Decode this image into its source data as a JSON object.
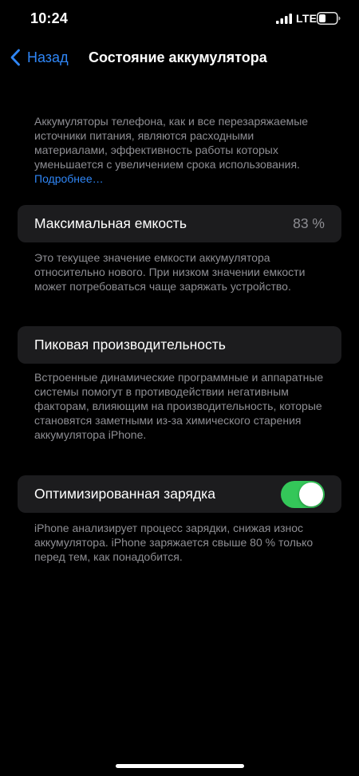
{
  "status_bar": {
    "time": "10:24",
    "network": "LTE",
    "signal_icon": "cellular-signal-icon",
    "battery_icon": "battery-icon"
  },
  "nav": {
    "back_label": "Назад",
    "back_icon": "chevron-left-icon",
    "title": "Состояние аккумулятора"
  },
  "intro": {
    "text": "Аккумуляторы телефона, как и все перезаряжаемые источники питания, являются расходными материалами, эффективность работы которых уменьшается с увеличением срока использования.",
    "link": "Подробнее…"
  },
  "capacity": {
    "label": "Максимальная емкость",
    "value": "83 %",
    "footer": "Это текущее значение емкости аккумулятора относительно нового. При низком значении емкости может потребоваться чаще заряжать устройство."
  },
  "peak": {
    "label": "Пиковая производительность",
    "footer": "Встроенные динамические программные и аппаратные системы помогут в противодействии негативным факторам, влияющим на производительность, которые становятся заметными из-за химического старения аккумулятора iPhone."
  },
  "charging": {
    "label": "Оптимизированная зарядка",
    "toggle_on": true,
    "footer": "iPhone анализирует процесс зарядки, снижая износ аккумулятора. iPhone заряжается свыше 80 % только перед тем, как понадобится."
  },
  "colors": {
    "background": "#000000",
    "cell": "#1c1c1e",
    "accent": "#2f86f6",
    "secondary_text": "#8e8e93",
    "toggle_on": "#34c759"
  }
}
